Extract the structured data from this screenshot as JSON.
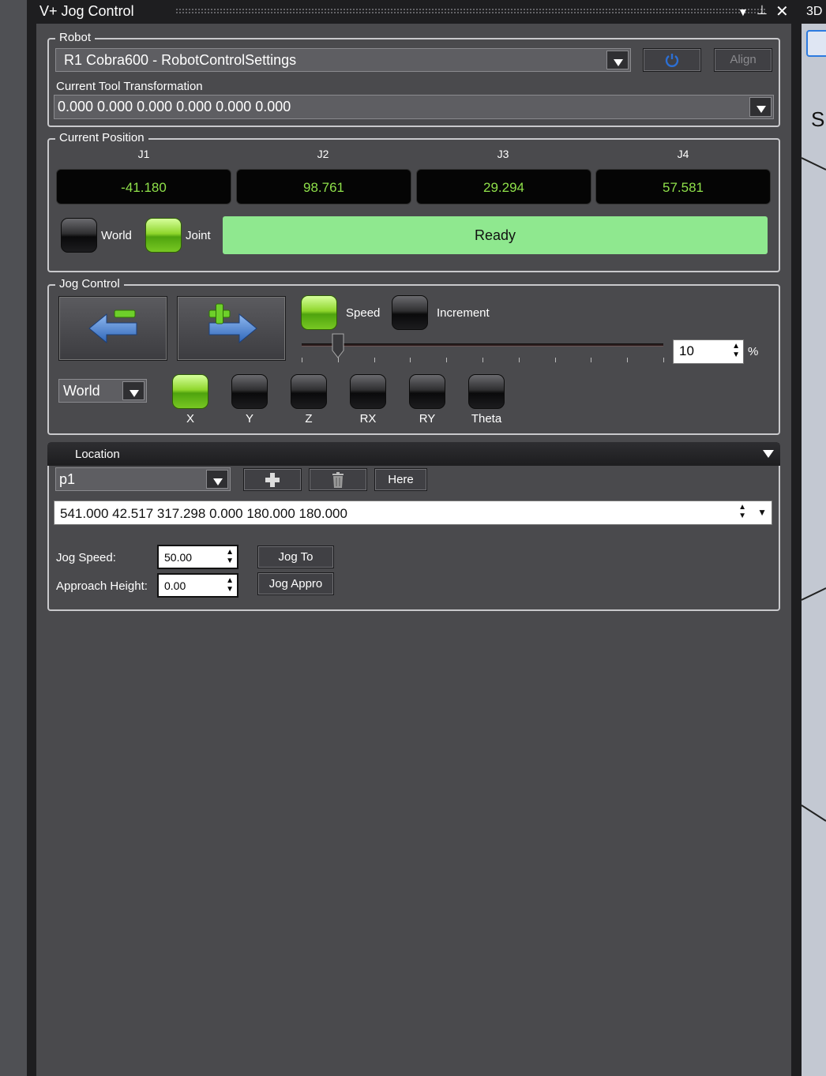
{
  "window": {
    "title": "V+ Jog Control",
    "neighbor_tab": "3D",
    "neighbor_glyph": "S"
  },
  "robot": {
    "legend": "Robot",
    "selected": "R1 Cobra600  -  RobotControlSettings",
    "align_label": "Align",
    "tool_label": "Current Tool Transformation",
    "tool_value": "0.000 0.000 0.000 0.000 0.000 0.000"
  },
  "position": {
    "legend": "Current Position",
    "joints": [
      {
        "label": "J1",
        "value": "-41.180"
      },
      {
        "label": "J2",
        "value": "98.761"
      },
      {
        "label": "J3",
        "value": "29.294"
      },
      {
        "label": "J4",
        "value": "57.581"
      }
    ],
    "world_label": "World",
    "joint_label": "Joint",
    "mode_selected": "Joint",
    "status": "Ready"
  },
  "jog": {
    "legend": "Jog Control",
    "speed_label": "Speed",
    "increment_label": "Increment",
    "mode_selected": "Speed",
    "speed_value": "10",
    "speed_unit": "%",
    "speed_fraction": 0.1,
    "frame": "World",
    "axes": [
      "X",
      "Y",
      "Z",
      "RX",
      "RY",
      "Theta"
    ],
    "axis_selected": "X"
  },
  "location": {
    "header": "Location",
    "selected": "p1",
    "here_label": "Here",
    "value": "541.000 42.517 317.298 0.000 180.000 180.000",
    "jog_speed_label": "Jog Speed:",
    "jog_speed_value": "50.00",
    "approach_label": "Approach Height:",
    "approach_value": "0.00",
    "jog_to_label": "Jog To",
    "jog_appro_label": "Jog Appro"
  },
  "colors": {
    "active_green": "#8fd62c",
    "ready_bg": "#8fe88f",
    "readout_text": "#8fe04a"
  }
}
